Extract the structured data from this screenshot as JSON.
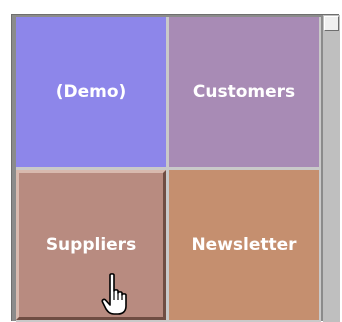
{
  "tiles": [
    {
      "label": "(Demo)",
      "color": "#8d86ea"
    },
    {
      "label": "Customers",
      "color": "#a88bb5"
    },
    {
      "label": "Suppliers",
      "color": "#b88b80"
    },
    {
      "label": "Newsletter",
      "color": "#c58f6f"
    }
  ],
  "pressed_tile": "Suppliers",
  "colors": {
    "frame": "#8b8b8b",
    "scrollbar_track": "#bfbfbf",
    "scrollbar_thumb": "#f0f0f0"
  },
  "cursor": {
    "icon": "hand-pointer-icon"
  }
}
